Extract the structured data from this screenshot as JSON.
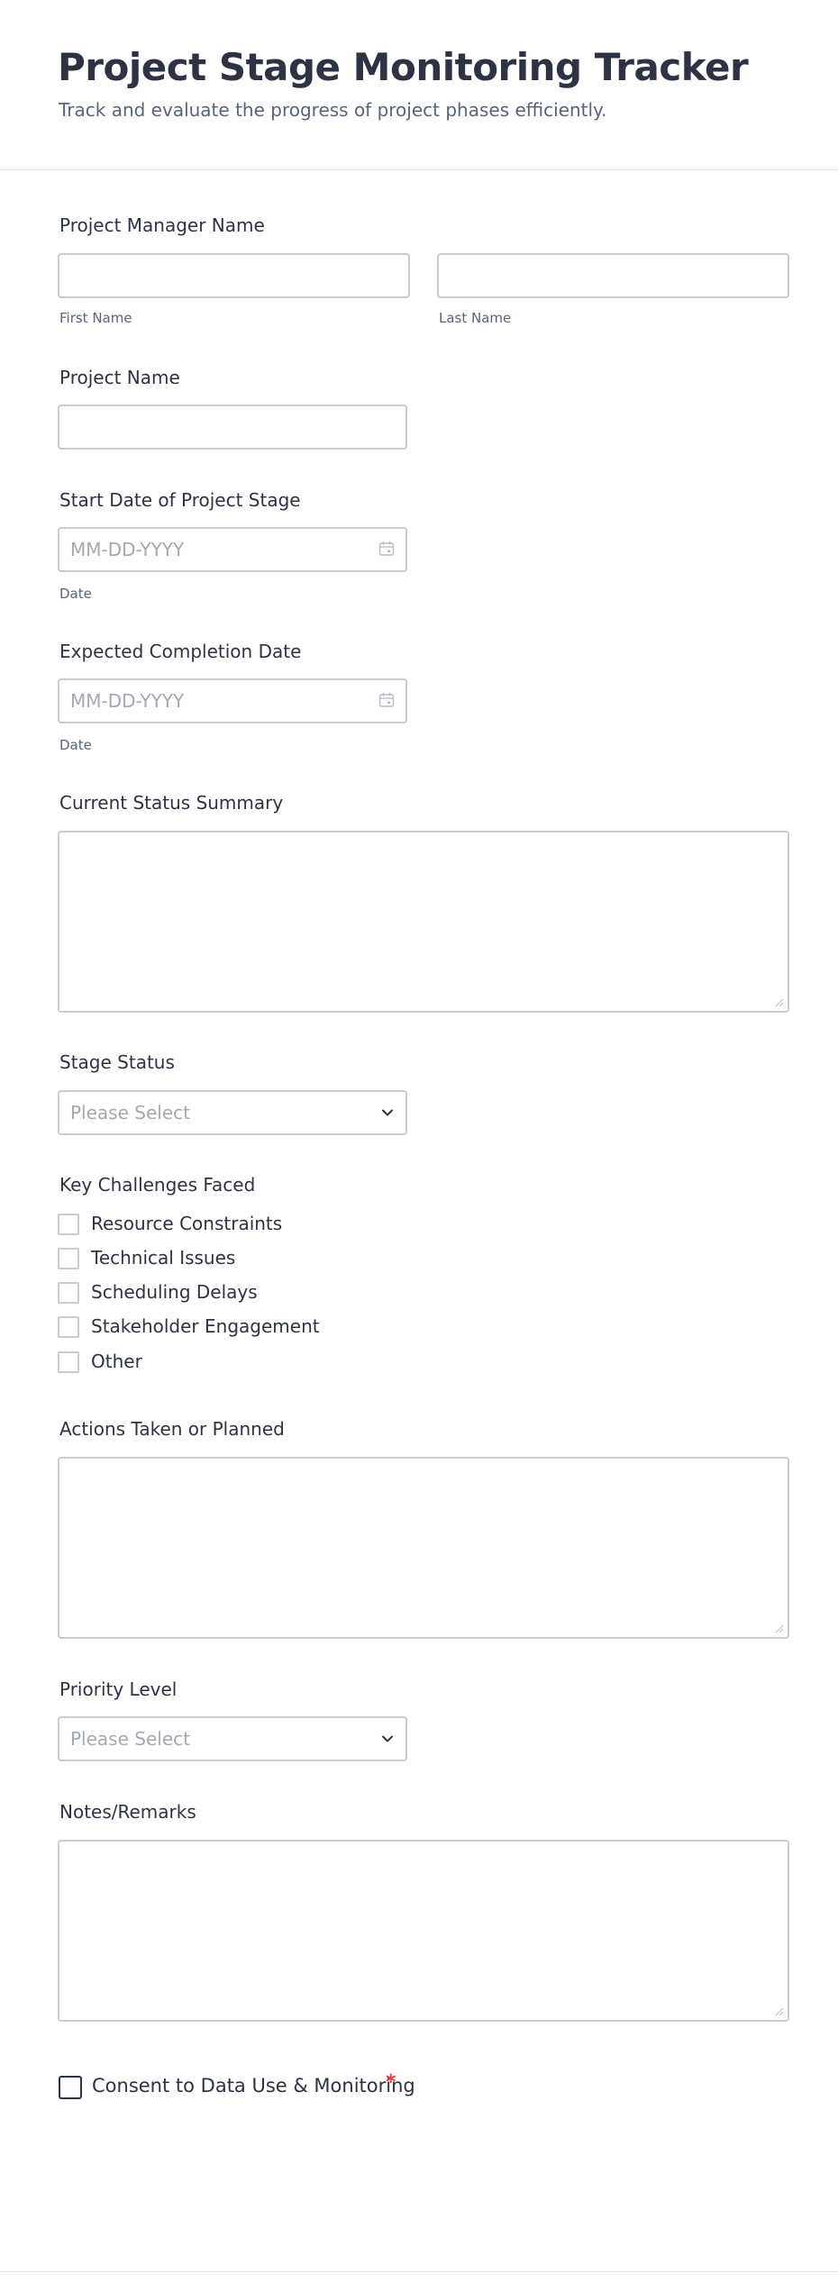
{
  "header": {
    "title": "Project Stage Monitoring Tracker",
    "subtitle": "Track and evaluate the progress of project phases efficiently."
  },
  "manager_name": {
    "label": "Project Manager Name",
    "first_value": "",
    "last_value": "",
    "first_sublabel": "First Name",
    "last_sublabel": "Last Name"
  },
  "project_name": {
    "label": "Project Name",
    "value": ""
  },
  "start_date": {
    "label": "Start Date of Project Stage",
    "placeholder": "MM-DD-YYYY",
    "sublabel": "Date"
  },
  "completion_date": {
    "label": "Expected Completion Date",
    "placeholder": "MM-DD-YYYY",
    "sublabel": "Date"
  },
  "status_summary": {
    "label": "Current Status Summary",
    "value": ""
  },
  "stage_status": {
    "label": "Stage Status",
    "placeholder": "Please Select"
  },
  "challenges": {
    "label": "Key Challenges Faced",
    "options": [
      "Resource Constraints",
      "Technical Issues",
      "Scheduling Delays",
      "Stakeholder Engagement",
      "Other"
    ]
  },
  "actions": {
    "label": "Actions Taken or Planned",
    "value": ""
  },
  "priority": {
    "label": "Priority Level",
    "placeholder": "Please Select"
  },
  "notes": {
    "label": "Notes/Remarks",
    "value": ""
  },
  "consent": {
    "label": "Consent to Data Use & Monitoring",
    "required_mark": "*"
  },
  "colors": {
    "text": "#2c3345",
    "muted": "#57647e",
    "border": "#c8ccd3",
    "required": "#f23a3c"
  },
  "icons": [
    "calendar-icon",
    "chevron-down-icon",
    "resize-grip-icon"
  ]
}
